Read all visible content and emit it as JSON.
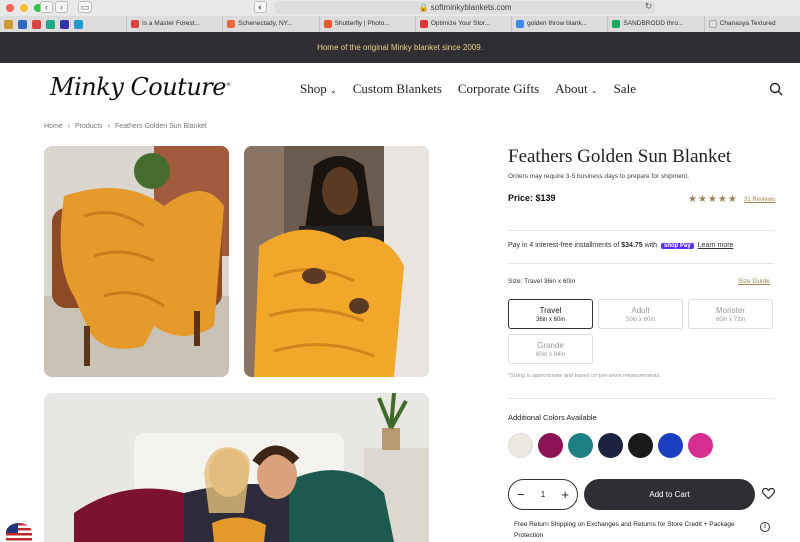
{
  "browser": {
    "url": "softminkyblankets.com",
    "tabs": [
      {
        "label": "Is a Master Forest...",
        "color": "#d44"
      },
      {
        "label": "Schenectady, NY...",
        "color": "#e64"
      },
      {
        "label": "Shutterfly | Photo...",
        "color": "#e53"
      },
      {
        "label": "Optimize Your Stor...",
        "color": "#d33"
      },
      {
        "label": "golden throw blank...",
        "color": "#4285f4"
      },
      {
        "label": "SANDBRODD thro...",
        "color": "#1a5"
      },
      {
        "label": "Chanasya Textured",
        "color": "#ddd"
      }
    ]
  },
  "announcement": "Home of the original Minky blanket since 2009.",
  "header": {
    "logo": "Minky Couture",
    "nav": [
      "Shop",
      "Custom Blankets",
      "Corporate Gifts",
      "About",
      "Sale"
    ]
  },
  "breadcrumb": [
    "Home",
    "Products",
    "Feathers Golden Sun Blanket"
  ],
  "product": {
    "title": "Feathers Golden Sun Blanket",
    "shipping_note": "Orders may require 3-5 business days to prepare for shipment.",
    "price_label": "Price:",
    "price": "$139",
    "stars": "★★★★★",
    "reviews": "31 Reviews",
    "installments_prefix": "Pay in 4 interest-free installments of ",
    "installments_amount": "$34.75",
    "installments_with": " with",
    "shoppay": "shop Pay",
    "learn_more": "Learn more",
    "size_label": "Size: Travel 36in x 60in",
    "size_guide": "Size Guide",
    "sizes": [
      {
        "name": "Travel",
        "dims": "36in x 60in"
      },
      {
        "name": "Adult",
        "dims": "50in x 60in"
      },
      {
        "name": "Monster",
        "dims": "60in x 72in"
      },
      {
        "name": "Grande",
        "dims": "60in x 84in"
      }
    ],
    "size_note": "*Sizing is approximate and based on pre-sewn measurements.",
    "colors_label": "Additional Colors Available",
    "colors": [
      "#ece9e2",
      "#8b1455",
      "#1e7f84",
      "#1c2340",
      "#1a1a1a",
      "#1c3fbf",
      "#d82d91"
    ],
    "quantity": "1",
    "add_to_cart": "Add to Cart",
    "return_note": "Free Return Shipping on Exchanges and Returns for Store Credit + Package Protection"
  }
}
